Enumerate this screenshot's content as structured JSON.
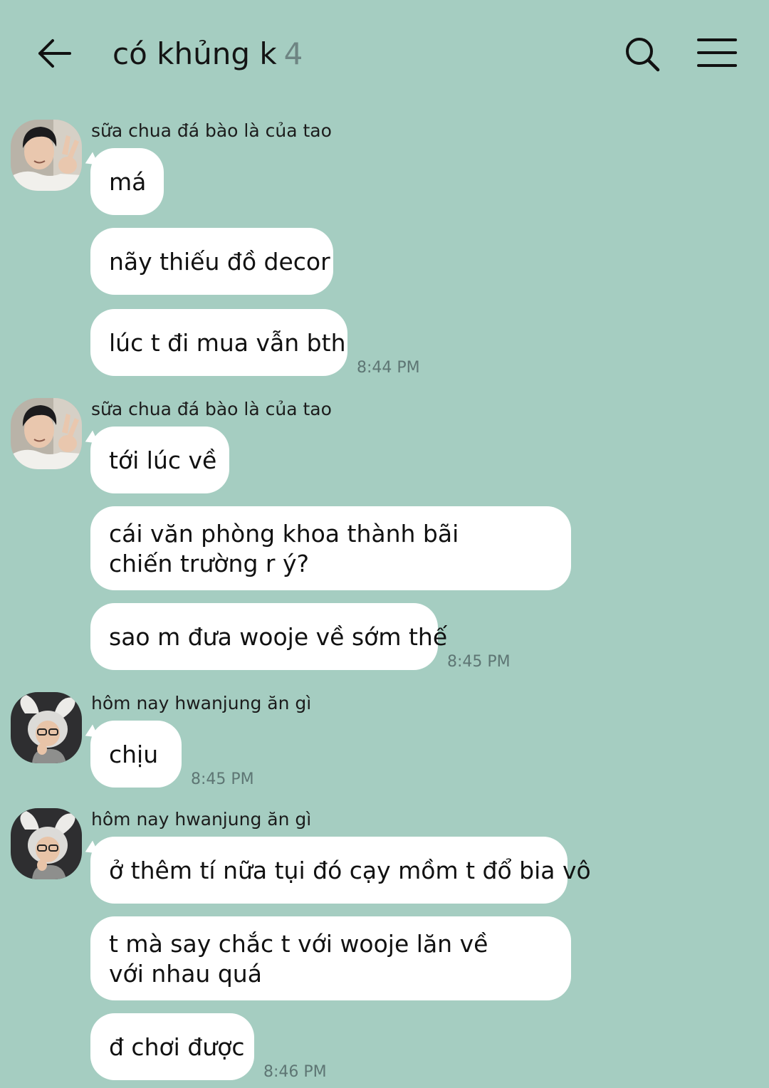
{
  "header": {
    "title": "có khủng k",
    "member_count": "4",
    "back_icon": "arrow-left-icon",
    "search_icon": "search-icon",
    "menu_icon": "hamburger-menu-icon"
  },
  "colors": {
    "background": "#a5cdc1",
    "bubble": "#ffffff",
    "timestamp": "#5e7674",
    "member_count": "#6e8583"
  },
  "groups": [
    {
      "sender": "sữa chua đá bào là của tao",
      "messages": [
        "má",
        "nãy thiếu đồ decor",
        "lúc t đi mua vẫn bth"
      ],
      "time": "8:44 PM"
    },
    {
      "sender": "sữa chua đá bào là của tao",
      "messages": [
        "tới lúc về",
        "cái văn phòng khoa thành bãi chiến trường r ý?",
        "sao m đưa wooje về sớm thế"
      ],
      "time": "8:45 PM"
    },
    {
      "sender": "hôm nay hwanjung ăn gì",
      "messages": [
        "chịu"
      ],
      "time": "8:45 PM"
    },
    {
      "sender": "hôm nay hwanjung ăn gì",
      "messages": [
        "ở thêm tí nữa tụi đó cạy mồm t đổ bia vô",
        "t mà say chắc t với wooje lăn về với nhau quá",
        "đ chơi được"
      ],
      "time": "8:46 PM"
    }
  ]
}
